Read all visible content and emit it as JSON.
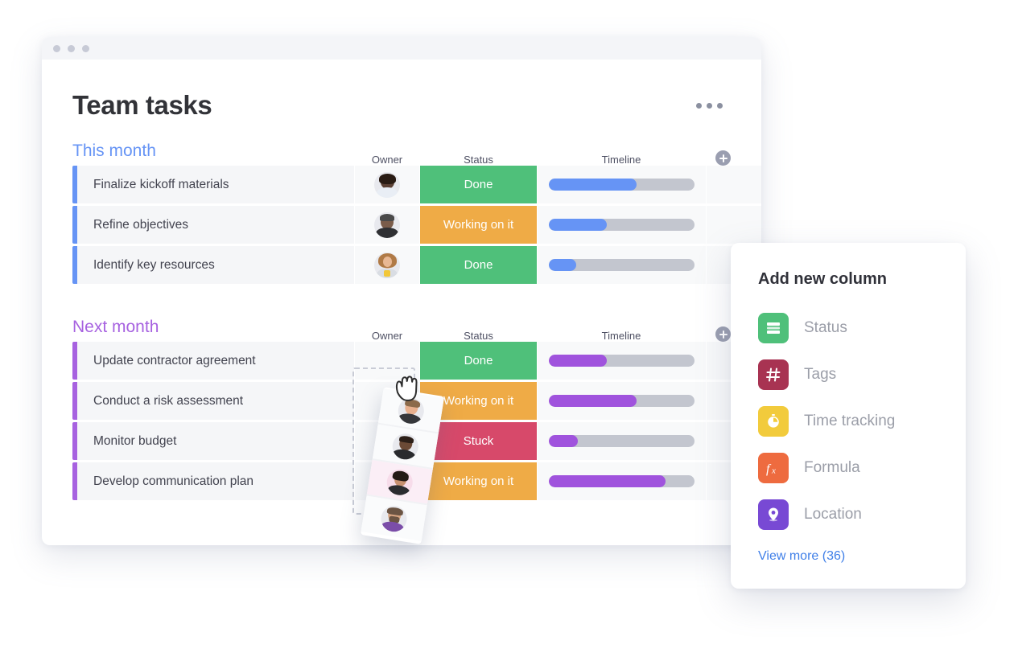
{
  "window": {
    "traffic_dots": [
      "dot-1",
      "dot-2",
      "dot-3"
    ],
    "board_title": "Team tasks",
    "menu_icon": "kebab-menu-icon"
  },
  "columns": {
    "owner": "Owner",
    "status": "Status",
    "timeline": "Timeline",
    "add_icon": "plus-circle-icon"
  },
  "groups": [
    {
      "id": "this-month",
      "title": "This month",
      "color": "#6694f5",
      "rows": [
        {
          "name": "Finalize kickoff materials",
          "status": "Done",
          "status_color": "#4fc07a",
          "progress": 60,
          "owner_avatar": "avatar-woman-glasses"
        },
        {
          "name": "Refine objectives",
          "status": "Working on it",
          "status_color": "#efab46",
          "progress": 40,
          "owner_avatar": "avatar-man-beard"
        },
        {
          "name": "Identify key resources",
          "status": "Done",
          "status_color": "#4fc07a",
          "progress": 19,
          "owner_avatar": "avatar-woman-blond"
        }
      ]
    },
    {
      "id": "next-month",
      "title": "Next month",
      "color": "#a762e0",
      "rows": [
        {
          "name": "Update contractor agreement",
          "status": "Done",
          "status_color": "#4fc07a",
          "progress": 40,
          "owner_avatar": "avatar-man-short-hair"
        },
        {
          "name": "Conduct a risk assessment",
          "status": "Working on it",
          "status_color": "#efab46",
          "progress": 60,
          "owner_avatar": "avatar-man-dark"
        },
        {
          "name": "Monitor budget",
          "status": "Stuck",
          "status_color": "#d7496a",
          "progress": 20,
          "owner_avatar": "avatar-woman-dark-hair"
        },
        {
          "name": "Develop communication plan",
          "status": "Working on it",
          "status_color": "#efab46",
          "progress": 80,
          "owner_avatar": "avatar-man-long-beard"
        }
      ]
    }
  ],
  "drag": {
    "cursor_icon": "grab-hand-cursor",
    "dragged_column": "Owner",
    "avatars": [
      "avatar-man-short-hair",
      "avatar-man-dark",
      "avatar-woman-dark-hair",
      "avatar-man-long-beard"
    ]
  },
  "popover": {
    "title": "Add new column",
    "items": [
      {
        "label": "Status",
        "icon": "status-bars-icon",
        "color": "#4fc07a"
      },
      {
        "label": "Tags",
        "icon": "hash-icon",
        "color": "#a83352"
      },
      {
        "label": "Time tracking",
        "icon": "timer-icon",
        "color": "#f2cb3c"
      },
      {
        "label": "Formula",
        "icon": "formula-fx-icon",
        "color": "#ee6b3f"
      },
      {
        "label": "Location",
        "icon": "location-pin-icon",
        "color": "#7849d4"
      }
    ],
    "view_more": "View more (36)"
  }
}
